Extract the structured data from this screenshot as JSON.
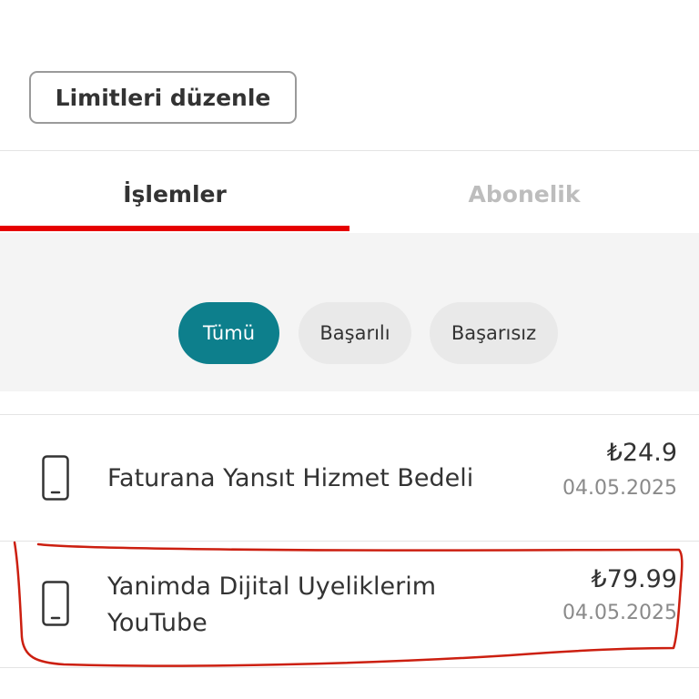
{
  "header": {
    "edit_limits_label": "Limitleri düzenle"
  },
  "tabs": [
    {
      "label": "İşlemler",
      "active": true
    },
    {
      "label": "Abonelik",
      "active": false
    }
  ],
  "filters": [
    {
      "label": "Tümü",
      "selected": true
    },
    {
      "label": "Başarılı",
      "selected": false
    },
    {
      "label": "Başarısız",
      "selected": false
    }
  ],
  "transactions": [
    {
      "title": "Faturana Yansıt Hizmet Bedeli",
      "amount": "₺24.9",
      "date": "04.05.2025",
      "icon": "phone-icon"
    },
    {
      "title": "Yanimda Dijital Uyeliklerim YouTube",
      "amount": "₺79.99",
      "date": "04.05.2025",
      "icon": "phone-icon"
    }
  ],
  "colors": {
    "accent_red": "#e60000",
    "filter_active": "#0d7f8c",
    "annotation_red": "#cc1f10"
  }
}
